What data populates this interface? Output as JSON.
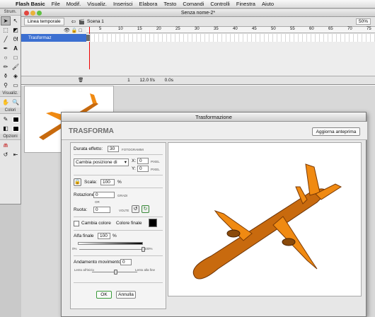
{
  "menubar": {
    "app": "Flash Basic",
    "items": [
      "File",
      "Modif.",
      "Visualiz.",
      "Inserisci",
      "Elabora",
      "Testo",
      "Comandi",
      "Controlli",
      "Finestra",
      "Aiuto"
    ]
  },
  "tools": {
    "header": "Strum.",
    "view_header": "Visualiz.",
    "colors_header": "Colori",
    "options_header": "Opzioni"
  },
  "document": {
    "title": "Senza nome-2*",
    "timeline_tab": "Linea temporale",
    "scene": "Scena 1",
    "zoom": "50%",
    "ruler_ticks": [
      "5",
      "10",
      "15",
      "20",
      "25",
      "30",
      "35",
      "40",
      "45",
      "50",
      "55",
      "60",
      "65",
      "70",
      "75"
    ],
    "layer_name": "Trasformaz",
    "frame": "1",
    "fps": "12.0 f/s",
    "time": "0.0s"
  },
  "dialog": {
    "window_title": "Trasformazione",
    "header_title": "TRASFORMA",
    "preview_button": "Aggiorna anteprima",
    "duration_label": "Durata effetto:",
    "duration_value": "30",
    "duration_unit": "FOTOGRAMMI",
    "position_select": "Cambia posizione di",
    "x_label": "X:",
    "x_value": "0",
    "x_unit": "PIXEL",
    "y_label": "Y:",
    "y_value": "0",
    "y_unit": "PIXEL",
    "scale_label": "Scala:",
    "scale_value": "100",
    "scale_unit": "%",
    "rotation_label": "Rotazione:",
    "rotation_value": "0",
    "rotation_unit": "GRADI",
    "or_label": "OR",
    "spin_label": "Ruota:",
    "spin_value": "0",
    "spin_unit": "VOLTE",
    "change_color_label": "Cambia colore",
    "final_color_label": "Colore finale",
    "final_color": "#000000",
    "alpha_label": "Alfa finale",
    "alpha_value": "100",
    "alpha_unit": "%",
    "alpha_min": "0%",
    "alpha_max": "100%",
    "alpha_level": 1.0,
    "easing_label": "Andamento movimento:",
    "easing_value": "0",
    "ease_in_label": "Lento all'inizio",
    "ease_out_label": "Lento alla fine",
    "easing_level": 0.5,
    "ok_button": "OK",
    "cancel_button": "Annulla"
  },
  "colors": {
    "airplane_body": "#c86a0e",
    "airplane_wing": "#f08a12",
    "selection": "#3b6fd1"
  }
}
